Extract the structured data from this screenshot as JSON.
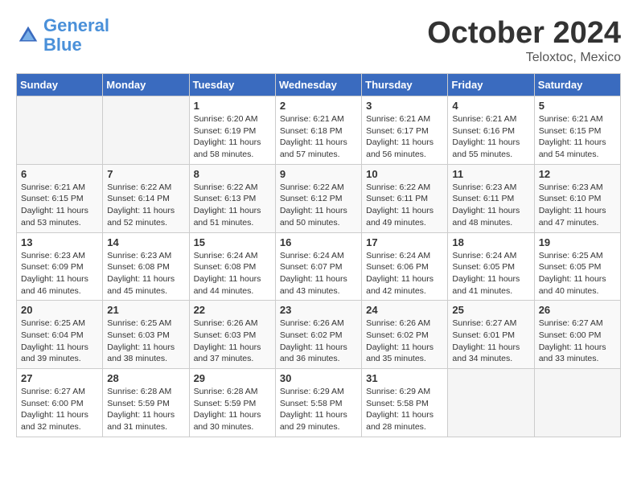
{
  "header": {
    "logo_line1": "General",
    "logo_line2": "Blue",
    "month_title": "October 2024",
    "location": "Teloxtoc, Mexico"
  },
  "weekdays": [
    "Sunday",
    "Monday",
    "Tuesday",
    "Wednesday",
    "Thursday",
    "Friday",
    "Saturday"
  ],
  "weeks": [
    [
      {
        "day": "",
        "empty": true
      },
      {
        "day": "",
        "empty": true
      },
      {
        "day": "1",
        "sunrise": "6:20 AM",
        "sunset": "6:19 PM",
        "daylight": "11 hours and 58 minutes."
      },
      {
        "day": "2",
        "sunrise": "6:21 AM",
        "sunset": "6:18 PM",
        "daylight": "11 hours and 57 minutes."
      },
      {
        "day": "3",
        "sunrise": "6:21 AM",
        "sunset": "6:17 PM",
        "daylight": "11 hours and 56 minutes."
      },
      {
        "day": "4",
        "sunrise": "6:21 AM",
        "sunset": "6:16 PM",
        "daylight": "11 hours and 55 minutes."
      },
      {
        "day": "5",
        "sunrise": "6:21 AM",
        "sunset": "6:15 PM",
        "daylight": "11 hours and 54 minutes."
      }
    ],
    [
      {
        "day": "6",
        "sunrise": "6:21 AM",
        "sunset": "6:15 PM",
        "daylight": "11 hours and 53 minutes."
      },
      {
        "day": "7",
        "sunrise": "6:22 AM",
        "sunset": "6:14 PM",
        "daylight": "11 hours and 52 minutes."
      },
      {
        "day": "8",
        "sunrise": "6:22 AM",
        "sunset": "6:13 PM",
        "daylight": "11 hours and 51 minutes."
      },
      {
        "day": "9",
        "sunrise": "6:22 AM",
        "sunset": "6:12 PM",
        "daylight": "11 hours and 50 minutes."
      },
      {
        "day": "10",
        "sunrise": "6:22 AM",
        "sunset": "6:11 PM",
        "daylight": "11 hours and 49 minutes."
      },
      {
        "day": "11",
        "sunrise": "6:23 AM",
        "sunset": "6:11 PM",
        "daylight": "11 hours and 48 minutes."
      },
      {
        "day": "12",
        "sunrise": "6:23 AM",
        "sunset": "6:10 PM",
        "daylight": "11 hours and 47 minutes."
      }
    ],
    [
      {
        "day": "13",
        "sunrise": "6:23 AM",
        "sunset": "6:09 PM",
        "daylight": "11 hours and 46 minutes."
      },
      {
        "day": "14",
        "sunrise": "6:23 AM",
        "sunset": "6:08 PM",
        "daylight": "11 hours and 45 minutes."
      },
      {
        "day": "15",
        "sunrise": "6:24 AM",
        "sunset": "6:08 PM",
        "daylight": "11 hours and 44 minutes."
      },
      {
        "day": "16",
        "sunrise": "6:24 AM",
        "sunset": "6:07 PM",
        "daylight": "11 hours and 43 minutes."
      },
      {
        "day": "17",
        "sunrise": "6:24 AM",
        "sunset": "6:06 PM",
        "daylight": "11 hours and 42 minutes."
      },
      {
        "day": "18",
        "sunrise": "6:24 AM",
        "sunset": "6:05 PM",
        "daylight": "11 hours and 41 minutes."
      },
      {
        "day": "19",
        "sunrise": "6:25 AM",
        "sunset": "6:05 PM",
        "daylight": "11 hours and 40 minutes."
      }
    ],
    [
      {
        "day": "20",
        "sunrise": "6:25 AM",
        "sunset": "6:04 PM",
        "daylight": "11 hours and 39 minutes."
      },
      {
        "day": "21",
        "sunrise": "6:25 AM",
        "sunset": "6:03 PM",
        "daylight": "11 hours and 38 minutes."
      },
      {
        "day": "22",
        "sunrise": "6:26 AM",
        "sunset": "6:03 PM",
        "daylight": "11 hours and 37 minutes."
      },
      {
        "day": "23",
        "sunrise": "6:26 AM",
        "sunset": "6:02 PM",
        "daylight": "11 hours and 36 minutes."
      },
      {
        "day": "24",
        "sunrise": "6:26 AM",
        "sunset": "6:02 PM",
        "daylight": "11 hours and 35 minutes."
      },
      {
        "day": "25",
        "sunrise": "6:27 AM",
        "sunset": "6:01 PM",
        "daylight": "11 hours and 34 minutes."
      },
      {
        "day": "26",
        "sunrise": "6:27 AM",
        "sunset": "6:00 PM",
        "daylight": "11 hours and 33 minutes."
      }
    ],
    [
      {
        "day": "27",
        "sunrise": "6:27 AM",
        "sunset": "6:00 PM",
        "daylight": "11 hours and 32 minutes."
      },
      {
        "day": "28",
        "sunrise": "6:28 AM",
        "sunset": "5:59 PM",
        "daylight": "11 hours and 31 minutes."
      },
      {
        "day": "29",
        "sunrise": "6:28 AM",
        "sunset": "5:59 PM",
        "daylight": "11 hours and 30 minutes."
      },
      {
        "day": "30",
        "sunrise": "6:29 AM",
        "sunset": "5:58 PM",
        "daylight": "11 hours and 29 minutes."
      },
      {
        "day": "31",
        "sunrise": "6:29 AM",
        "sunset": "5:58 PM",
        "daylight": "11 hours and 28 minutes."
      },
      {
        "day": "",
        "empty": true
      },
      {
        "day": "",
        "empty": true
      }
    ]
  ],
  "labels": {
    "sunrise": "Sunrise:",
    "sunset": "Sunset:",
    "daylight": "Daylight:"
  }
}
